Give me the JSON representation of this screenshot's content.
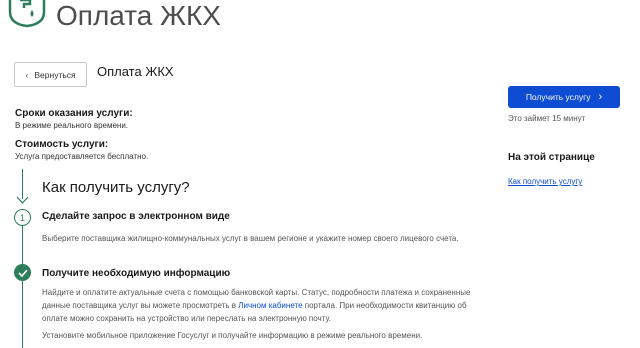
{
  "header": {
    "logo_text": "Оплата ЖКХ",
    "icon": "faucet-drop-icon"
  },
  "nav": {
    "back_label": "Вернуться",
    "back_icon": "chevron-left-icon"
  },
  "page": {
    "title": "Оплата ЖКХ"
  },
  "info": {
    "terms_label": "Сроки оказания услуги:",
    "terms_value": "В режиме реального времени.",
    "cost_label": "Стоимость услуги:",
    "cost_value": "Услуга предоставляется бесплатно."
  },
  "how": {
    "title": "Как получить услугу?",
    "step1": {
      "number": "1",
      "title": "Сделайте запрос в электронном виде",
      "text": "Выберите поставщика жилищно-коммунальных услуг в вашем регионе и укажите номер своего лицевого счета."
    },
    "step2": {
      "title": "Получите необходимую информацию",
      "text_before": "Найдите и оплатите актуальные счета с помощью банковской карты. Статус, подробности платежа и сохраненные данные поставщика услуг вы можете просмотреть в",
      "link": "Личном кабинете",
      "text_after": "портала. При необходимости квитанцию об оплате можно сохранить на устройство или переслать на электронную почту.",
      "text2": "Установите мобильное приложение Госуслуг и получайте информацию в режиме реального времени."
    }
  },
  "sidebar": {
    "button_label": "Получить услугу",
    "button_icon": "chevron-right-icon",
    "time_note": "Это займет 15 минут",
    "on_page_title": "На этой странице",
    "on_page_link": "Как получить услугу"
  },
  "colors": {
    "accent": "#0d4cd3",
    "green": "#2e7d5a"
  }
}
